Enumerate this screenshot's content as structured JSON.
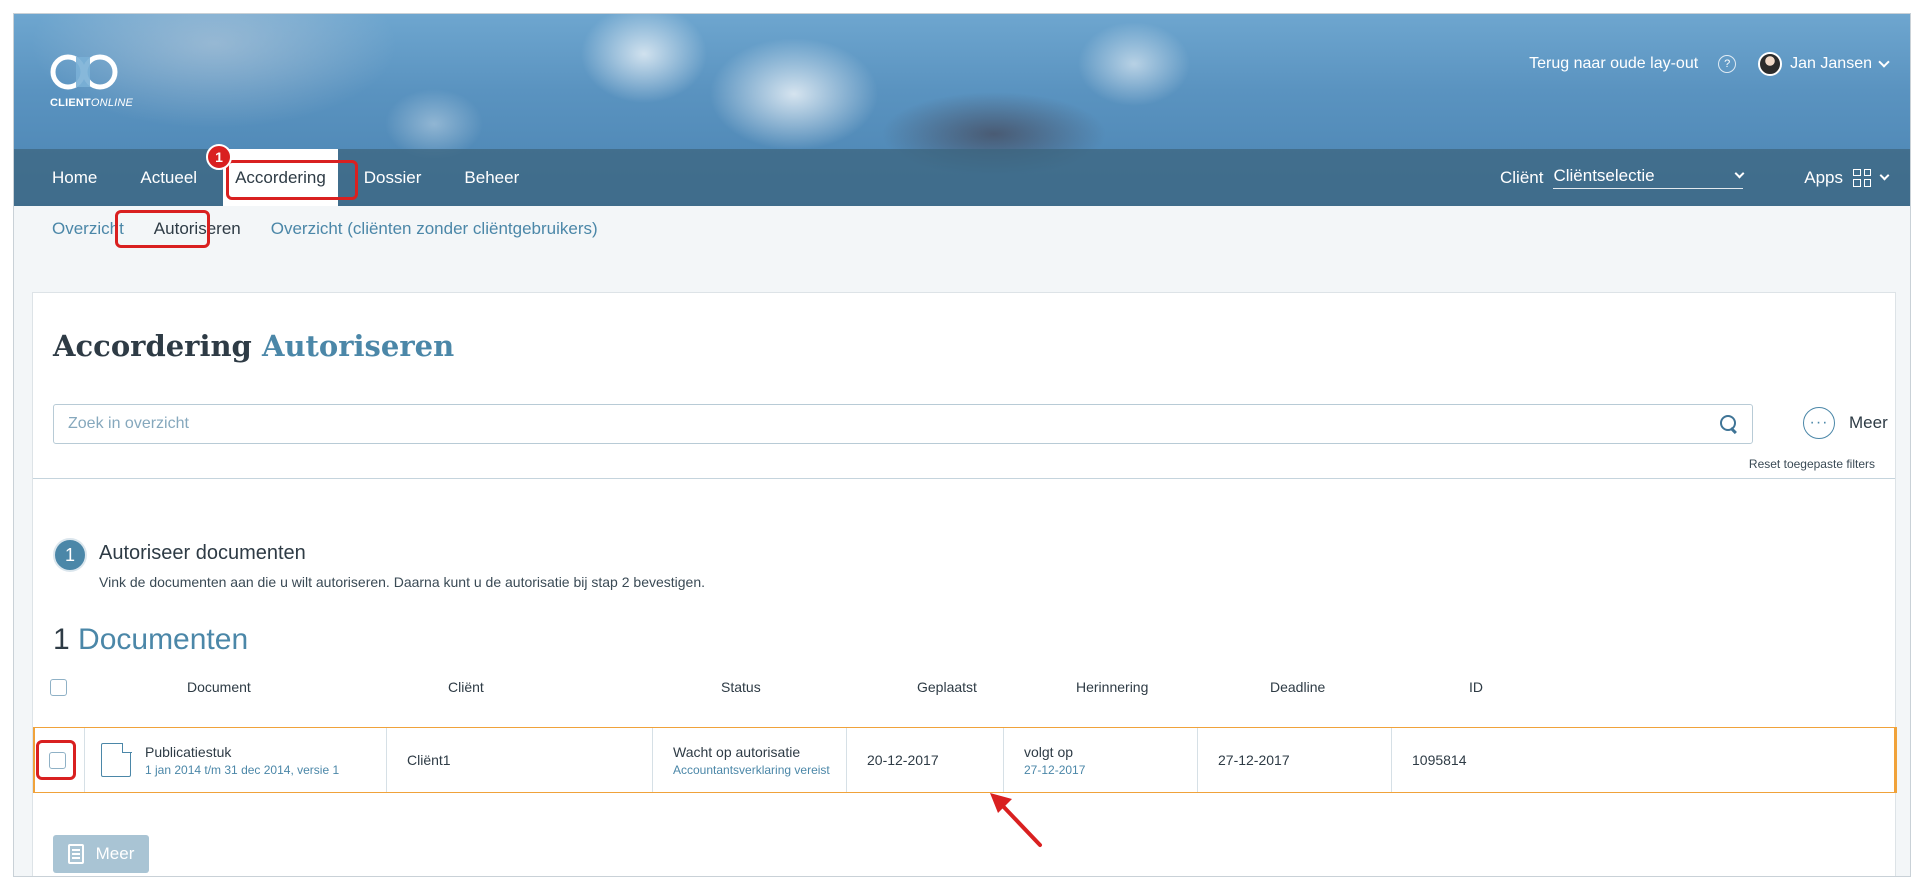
{
  "app": {
    "brand": "CLIENTONLINE",
    "brand_bold": "CLIENT",
    "brand_italic": "ONLINE"
  },
  "header": {
    "back_link": "Terug naar oude lay-out",
    "help": "?",
    "user_name": "Jan Jansen"
  },
  "nav": {
    "items": [
      {
        "label": "Home",
        "active": false
      },
      {
        "label": "Actueel",
        "active": false
      },
      {
        "label": "Accordering",
        "active": true
      },
      {
        "label": "Dossier",
        "active": false
      },
      {
        "label": "Beheer",
        "active": false
      }
    ],
    "badge": "1",
    "client_label": "Cliënt",
    "client_value": "Cliëntselectie",
    "apps_label": "Apps"
  },
  "subnav": {
    "items": [
      {
        "label": "Overzicht",
        "active": false
      },
      {
        "label": "Autoriseren",
        "active": true
      },
      {
        "label": "Overzicht (cliënten zonder cliëntgebruikers)",
        "active": false
      }
    ]
  },
  "page": {
    "title_main": "Accordering",
    "title_accent": "Autoriseren",
    "search_placeholder": "Zoek in overzicht",
    "more_label": "Meer",
    "dots": "···",
    "reset_filters": "Reset toegepaste filters"
  },
  "step": {
    "number": "1",
    "title": "Autoriseer documenten",
    "description": "Vink de documenten aan die u wilt autoriseren. Daarna kunt u de autorisatie bij stap 2 bevestigen."
  },
  "documents": {
    "count": "1",
    "label": "Documenten",
    "columns": [
      "Document",
      "Cliënt",
      "Status",
      "Geplaatst",
      "Herinnering",
      "Deadline",
      "ID"
    ],
    "rows": [
      {
        "document": "Publicatiestuk",
        "document_sub": "1 jan 2014 t/m 31 dec 2014, versie 1",
        "client": "Cliënt1",
        "status": "Wacht op autorisatie",
        "status_sub": "Accountantsverklaring vereist",
        "placed": "20-12-2017",
        "reminder": "volgt op",
        "reminder_sub": "27-12-2017",
        "deadline": "27-12-2017",
        "id": "1095814"
      }
    ],
    "bulk_button": "Meer"
  },
  "colors": {
    "accent": "#4b87a8",
    "annotation": "#d92020",
    "row_highlight": "#f0a23a"
  }
}
